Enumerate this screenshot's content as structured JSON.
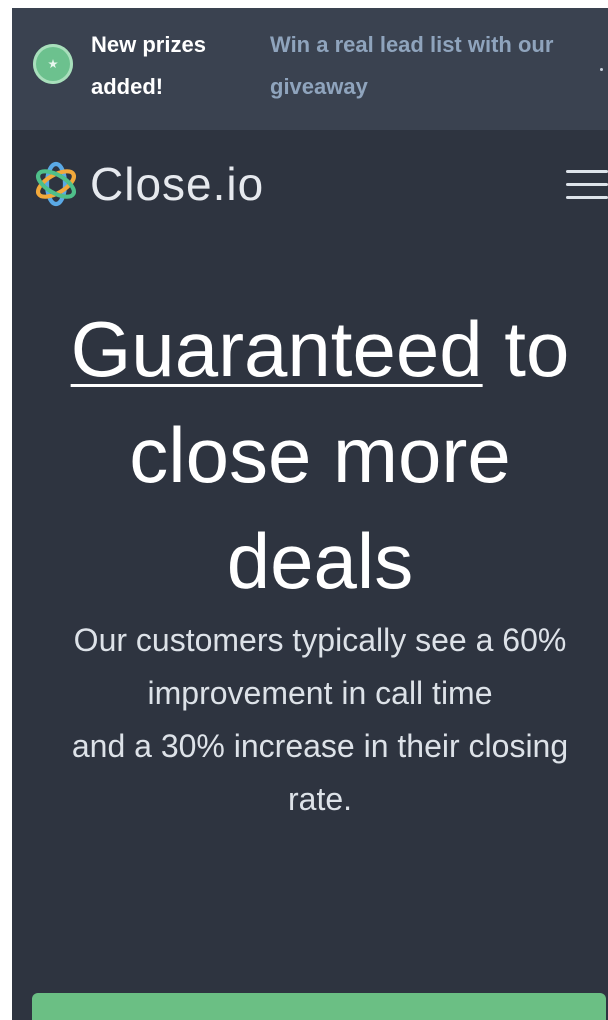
{
  "announcement": {
    "title": "New prizes added!",
    "message": "Win a real lead list with our giveaway",
    "badge_icon": "star-badge-icon",
    "badge_color": "#6cc18e"
  },
  "header": {
    "logo_text": "Close.io",
    "logo_icon": "close-io-logo-icon",
    "menu_icon": "hamburger-menu-icon"
  },
  "hero": {
    "title_underlined": "Guaranteed",
    "title_rest_1": " to",
    "title_line_2": "close more",
    "title_line_3": "deals",
    "subtitle_line_1": "Our customers typically see a 60%",
    "subtitle_line_2": "improvement in call time",
    "subtitle_line_3": "and a 30% increase in their closing",
    "subtitle_line_4": "rate."
  },
  "colors": {
    "background": "#2e3440",
    "announcement_bg": "#3a4250",
    "cta": "#6bbf84",
    "accent_link": "#8fa4bd"
  }
}
